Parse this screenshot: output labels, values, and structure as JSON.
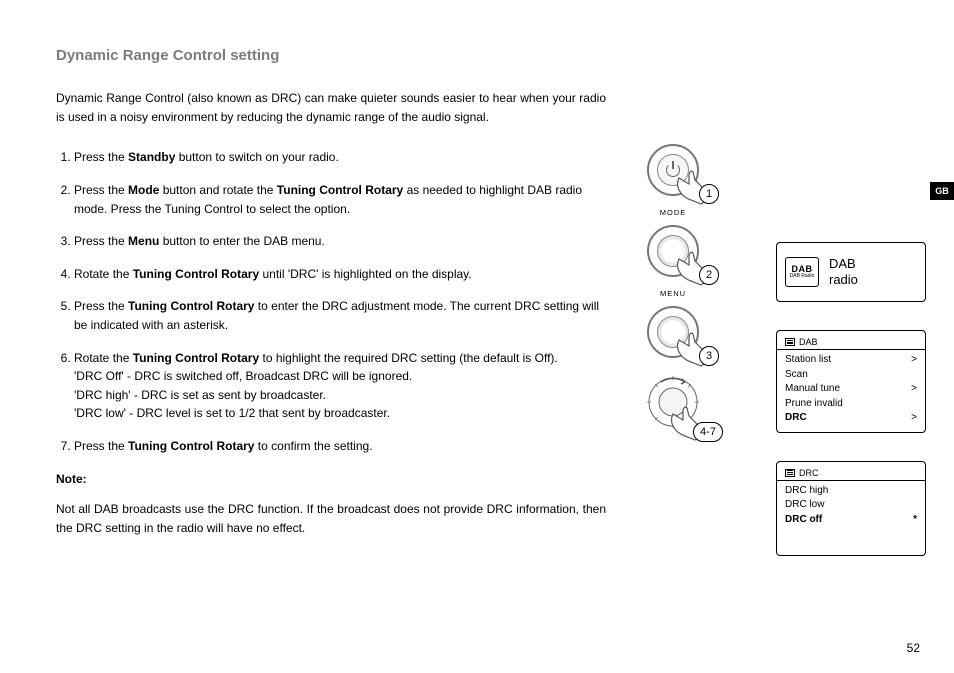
{
  "language_tab": "GB",
  "page_number": "52",
  "heading": "Dynamic Range Control setting",
  "intro": "Dynamic Range Control (also known as DRC) can make quieter sounds easier to hear when your radio is used in a noisy environment by reducing the dynamic range of the audio signal.",
  "steps": {
    "s1_a": "Press the ",
    "s1_b": "Standby",
    "s1_c": " button to switch on your radio.",
    "s2_a": "Press the ",
    "s2_b": "Mode",
    "s2_c": " button and rotate the ",
    "s2_d": "Tuning Control Rotary",
    "s2_e": " as needed to highlight DAB radio mode. Press the Tuning Control to select the option.",
    "s3_a": "Press the ",
    "s3_b": "Menu",
    "s3_c": " button to enter the DAB menu.",
    "s4_a": "Rotate the ",
    "s4_b": "Tuning Control Rotary",
    "s4_c": " until 'DRC' is highlighted on the display.",
    "s5_a": "Press the ",
    "s5_b": "Tuning Control Rotary",
    "s5_c": " to enter the DRC adjustment mode. The current DRC setting will be indicated with an asterisk.",
    "s6_a": "Rotate the ",
    "s6_b": "Tuning Control Rotary",
    "s6_c": " to highlight the required DRC setting (the default is Off).",
    "s6_sub1": "'DRC Off' - DRC is switched off, Broadcast DRC will be ignored.",
    "s6_sub2": "'DRC high' - DRC is set as sent by broadcaster.",
    "s6_sub3": "'DRC low' - DRC level is set to 1/2 that sent by broadcaster.",
    "s7_a": "Press the ",
    "s7_b": "Tuning Control Rotary",
    "s7_c": " to confirm the setting."
  },
  "note_label": "Note:",
  "note_body": "Not all DAB broadcasts use the DRC function. If the broadcast does not provide DRC information, then the DRC setting in the radio will have no effect.",
  "illus": {
    "n1": "1",
    "n2": "2",
    "n3": "3",
    "n47": "4-7",
    "mode_label": "MODE",
    "menu_label": "MENU"
  },
  "display_mode": {
    "logo_big": "DAB",
    "logo_small": "DAB Radio",
    "title_line1": "DAB",
    "title_line2": "radio"
  },
  "display_dab": {
    "header": "DAB",
    "r1": "Station list",
    "r2": "Scan",
    "r3": "Manual tune",
    "r4": "Prune invalid",
    "r5": "DRC"
  },
  "display_drc": {
    "header": "DRC",
    "r1": "DRC high",
    "r2": "DRC low",
    "r3": "DRC off"
  }
}
